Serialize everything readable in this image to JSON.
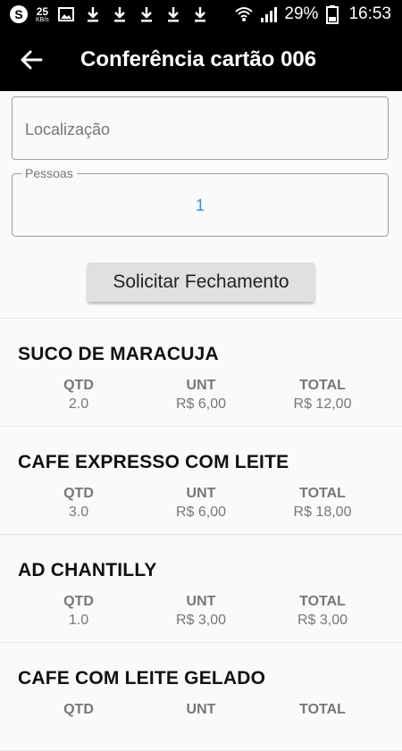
{
  "statusbar": {
    "speed_value": "25",
    "speed_unit": "KB/s",
    "battery": "29%",
    "time": "16:53"
  },
  "appbar": {
    "title": "Conferência cartão 006"
  },
  "form": {
    "location_placeholder": "Localização",
    "people_label": "Pessoas",
    "people_value": "1",
    "close_button": "Solicitar Fechamento"
  },
  "items": [
    {
      "name": "SUCO DE MARACUJA",
      "qtd_label": "QTD",
      "qtd": "2.0",
      "unt_label": "UNT",
      "unt": "R$ 6,00",
      "total_label": "TOTAL",
      "total": "R$ 12,00"
    },
    {
      "name": "CAFE EXPRESSO COM LEITE",
      "qtd_label": "QTD",
      "qtd": "3.0",
      "unt_label": "UNT",
      "unt": "R$ 6,00",
      "total_label": "TOTAL",
      "total": "R$ 18,00"
    },
    {
      "name": "AD CHANTILLY",
      "qtd_label": "QTD",
      "qtd": "1.0",
      "unt_label": "UNT",
      "unt": "R$ 3,00",
      "total_label": "TOTAL",
      "total": "R$ 3,00"
    },
    {
      "name": "CAFE COM LEITE GELADO",
      "qtd_label": "QTD",
      "qtd": "",
      "unt_label": "UNT",
      "unt": "",
      "total_label": "TOTAL",
      "total": ""
    }
  ]
}
